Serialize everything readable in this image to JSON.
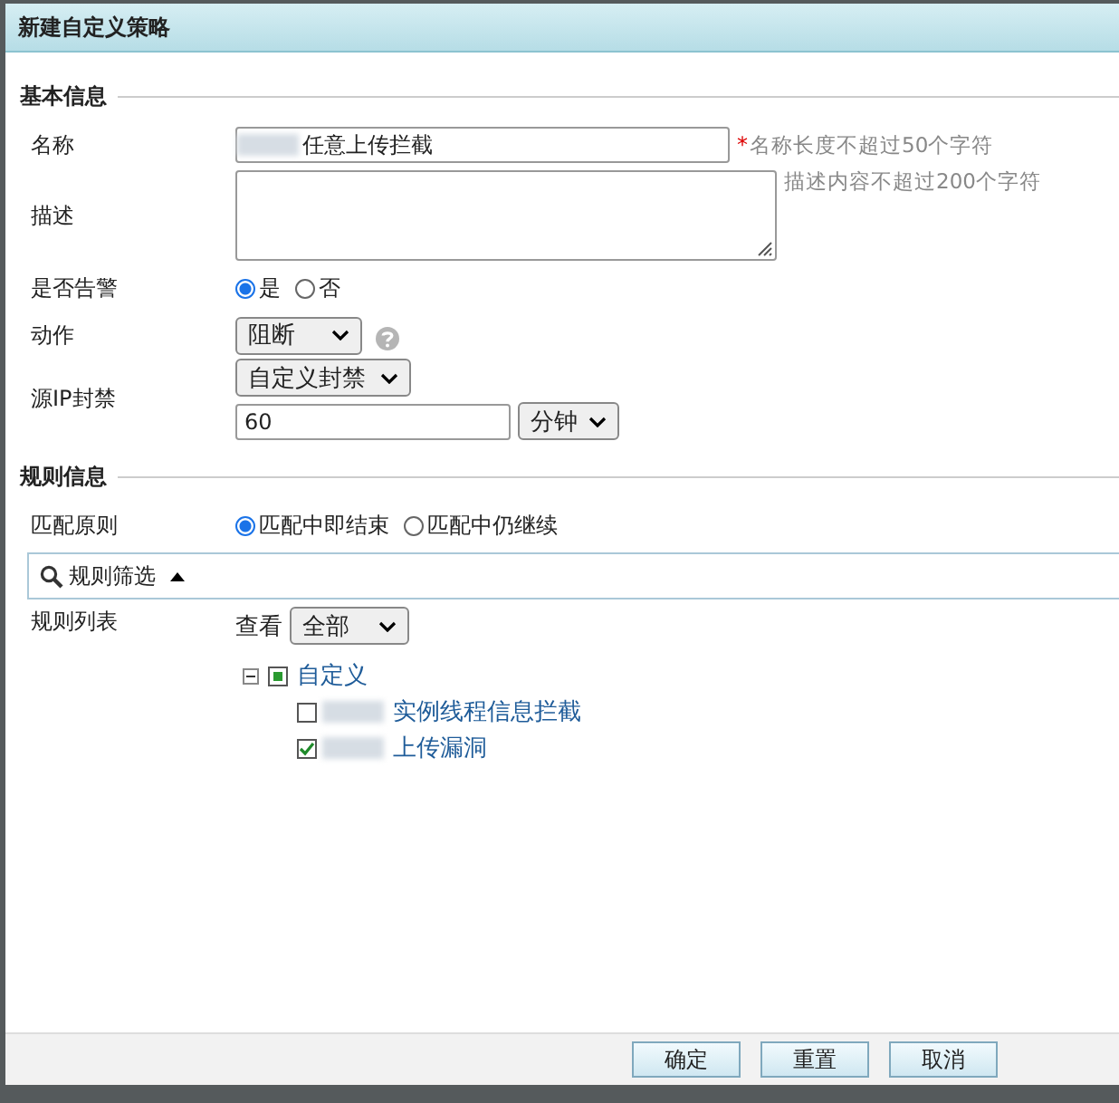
{
  "window": {
    "title": "新建自定义策略"
  },
  "basic": {
    "heading": "基本信息",
    "name": {
      "label": "名称",
      "value": "任意上传拦截",
      "required_mark": "*",
      "hint": "名称长度不超过50个字符"
    },
    "description": {
      "label": "描述",
      "hint": "描述内容不超过200个字符"
    },
    "alarm": {
      "label": "是否告警",
      "options": [
        {
          "label": "是",
          "selected": true
        },
        {
          "label": "否",
          "selected": false
        }
      ]
    },
    "action": {
      "label": "动作",
      "value": "阻断"
    },
    "ip_ban": {
      "label": "源IP封禁",
      "mode": "自定义封禁",
      "duration": "60",
      "unit": "分钟"
    }
  },
  "rules": {
    "heading": "规则信息",
    "match": {
      "label": "匹配原则",
      "options": [
        {
          "label": "匹配中即结束",
          "selected": true
        },
        {
          "label": "匹配中仍继续",
          "selected": false
        }
      ]
    },
    "filter": {
      "label": "规则筛选",
      "expanded": true
    },
    "list": {
      "label": "规则列表",
      "view_label": "查看",
      "view_value": "全部",
      "tree": [
        {
          "label": "自定义",
          "expanded": true,
          "partial": true,
          "children": [
            {
              "label": "实例线程信息拦截",
              "checked": false
            },
            {
              "label": "上传漏洞",
              "checked": true
            }
          ]
        }
      ]
    }
  },
  "buttons": [
    "确定",
    "重置",
    "取消"
  ]
}
